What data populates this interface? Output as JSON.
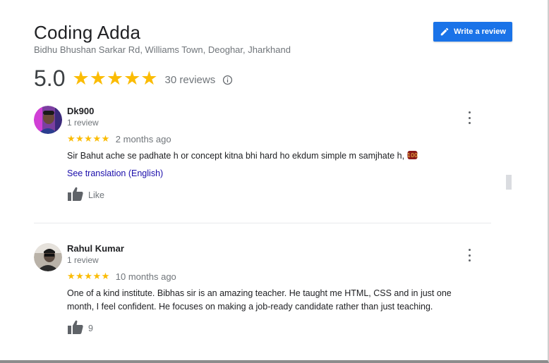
{
  "place": {
    "name": "Coding Adda",
    "address": "Bidhu Bhushan Sarkar Rd, Williams Town, Deoghar, Jharkhand"
  },
  "header": {
    "write_review_label": "Write a review",
    "rating": "5.0",
    "stars": "★★★★★",
    "review_count": "30 reviews"
  },
  "reviews": [
    {
      "name": "Dk900",
      "meta": "1 review",
      "stars": "★★★★★",
      "rating": 5,
      "date": "2 months ago",
      "text": "Sir Bahut ache se padhate h or concept kitna bhi hard ho ekdum simple m samjhate h,",
      "translation_link": "See translation (English)",
      "like_label": "Like"
    },
    {
      "name": "Rahul Kumar",
      "meta": "1 review",
      "stars": "★★★★★",
      "rating": 5,
      "date": "10 months ago",
      "text": "One of a kind institute. Bibhas sir is an amazing teacher. He taught me HTML, CSS and in just one month, I feel confident. He focuses on making a job-ready candidate rather than just teaching.",
      "like_label": "9"
    }
  ],
  "colors": {
    "accent": "#1a73e8",
    "star": "#fbbc04",
    "link": "#1a0dab",
    "secondary_text": "#70757a"
  },
  "icons": {
    "write_button": "pencil-icon",
    "info": "info-icon",
    "more": "more-vert-icon",
    "like": "thumb-up-icon"
  }
}
